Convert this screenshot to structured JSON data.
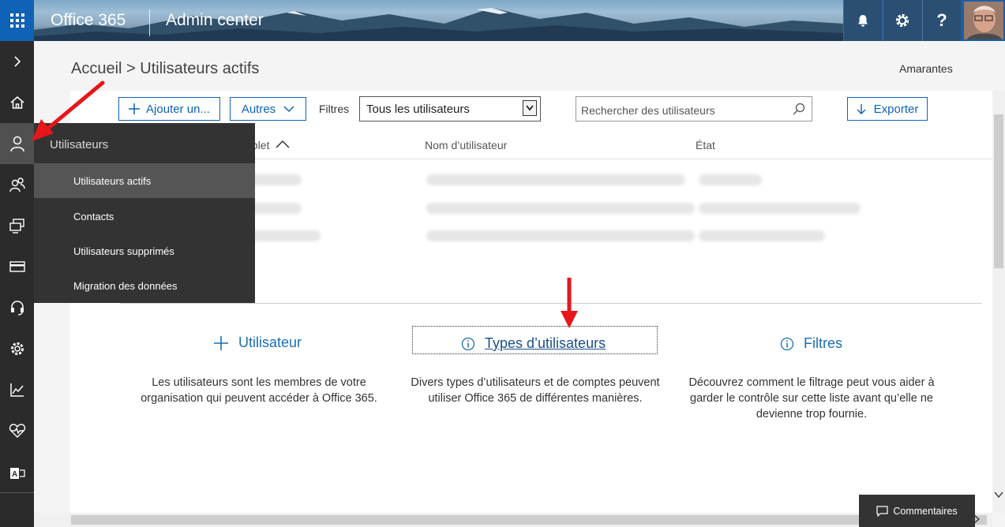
{
  "header": {
    "brand": "Office 365",
    "app_title": "Admin center",
    "icons": [
      "waffle-icon",
      "bell-icon",
      "gear-icon",
      "help-icon"
    ],
    "help_label": "?"
  },
  "rail": {
    "icons": [
      "chevron-right-icon",
      "home-icon",
      "user-icon",
      "groups-icon",
      "resources-icon",
      "billing-icon",
      "support-icon",
      "settings-icon",
      "reports-icon",
      "health-icon",
      "exchange-icon"
    ]
  },
  "breadcrumb": "Accueil > Utilisateurs actifs",
  "tenant": "Amarantes",
  "toolbar": {
    "add_label": "Ajouter un...",
    "more_label": "Autres",
    "filter_label": "Filtres",
    "filter_value": "Tous les utilisateurs",
    "search_placeholder": "Rechercher des utilisateurs",
    "export_label": "Exporter"
  },
  "table": {
    "columns": [
      "Nom complet",
      "Nom d’utilisateur",
      "État"
    ],
    "visible_first_col_fragment": "nplet"
  },
  "flyout": {
    "title": "Utilisateurs",
    "items": [
      "Utilisateurs actifs",
      "Contacts",
      "Utilisateurs supprimés",
      "Migration des données"
    ]
  },
  "cards": [
    {
      "title": "Utilisateur",
      "text": "Les utilisateurs sont les membres de votre organisation qui peuvent accéder à Office 365."
    },
    {
      "title": "Types d’utilisateurs",
      "text": "Divers types d’utilisateurs et de comptes peuvent utiliser Office 365 de différentes manières."
    },
    {
      "title": "Filtres",
      "text": "Découvrez comment le filtrage peut vous aider à garder le contrôle sur cette liste avant qu’elle ne devienne trop fournie."
    }
  ],
  "feedback_label": "Commentaires",
  "colors": {
    "accent": "#0f62b5",
    "annotation_arrow": "#e8151a",
    "rail_bg": "#2b2b2b",
    "flyout_bg": "#333333"
  }
}
